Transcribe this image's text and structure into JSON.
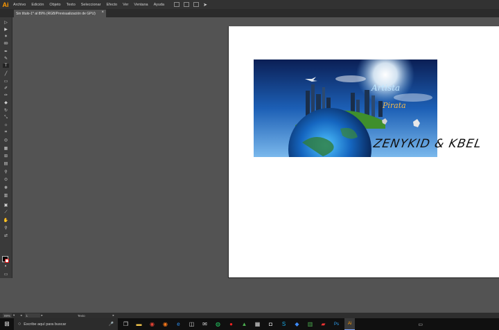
{
  "app": {
    "logo": "Ai"
  },
  "menu": [
    "Archivo",
    "Edición",
    "Objeto",
    "Texto",
    "Seleccionar",
    "Efecto",
    "Ver",
    "Ventana",
    "Ayuda"
  ],
  "document": {
    "tab_title": "Sin título-1* al 89% (RGB/Previsualización de GPU)",
    "close_glyph": "×"
  },
  "artwork": {
    "title_line1": "Artista",
    "title_line2": "Pirata",
    "overlay_text": "ZENYKID & KBEL"
  },
  "status": {
    "zoom": "89%",
    "artboard": "1",
    "tool": "Texto"
  },
  "taskbar": {
    "search_placeholder": "Escribe aquí para buscar"
  },
  "colors": {
    "accent": "#ff9a00",
    "canvas_bg": "#535353",
    "menubar_bg": "#323232"
  }
}
